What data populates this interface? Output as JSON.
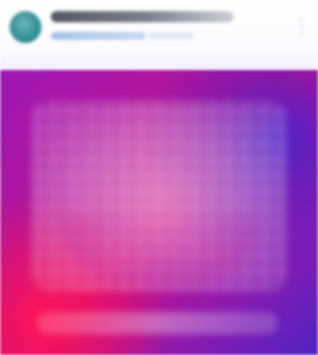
{
  "theme": {
    "header_background": "#ffffff",
    "avatar_color": "#2f8e95",
    "title_color": "#3f4555",
    "subtitle_color": "#9fbfe8",
    "visual_gradient_colors": [
      "#ff1453",
      "#cf0d85",
      "#9d17b5",
      "#4f22c2"
    ],
    "overlay_color": "#ffffff"
  },
  "header": {
    "avatar_icon": "avatar-icon",
    "menu_icon": "more-vertical-icon"
  }
}
